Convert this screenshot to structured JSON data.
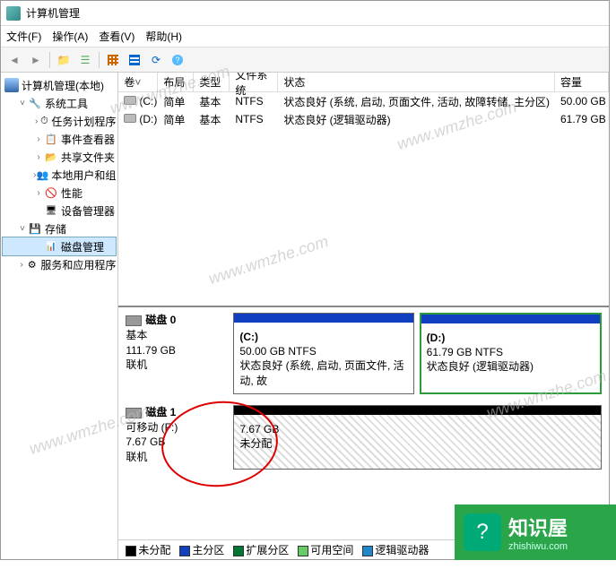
{
  "window": {
    "title": "计算机管理"
  },
  "menu": {
    "file": "文件(F)",
    "action": "操作(A)",
    "view": "查看(V)",
    "help": "帮助(H)"
  },
  "tree": {
    "root": "计算机管理(本地)",
    "systools": "系统工具",
    "task": "任务计划程序",
    "event": "事件查看器",
    "share": "共享文件夹",
    "users": "本地用户和组",
    "perf": "性能",
    "devmgr": "设备管理器",
    "storage": "存储",
    "diskmgmt": "磁盘管理",
    "services": "服务和应用程序"
  },
  "vol_headers": {
    "vol": "卷",
    "layout": "布局",
    "type": "类型",
    "fs": "文件系统",
    "status": "状态",
    "cap": "容量"
  },
  "volumes": [
    {
      "name": "(C:)",
      "layout": "简单",
      "type": "基本",
      "fs": "NTFS",
      "status": "状态良好 (系统, 启动, 页面文件, 活动, 故障转储, 主分区)",
      "cap": "50.00 GB"
    },
    {
      "name": "(D:)",
      "layout": "简单",
      "type": "基本",
      "fs": "NTFS",
      "status": "状态良好 (逻辑驱动器)",
      "cap": "61.79 GB"
    }
  ],
  "disks": {
    "d0": {
      "name": "磁盘 0",
      "type": "基本",
      "size": "111.79 GB",
      "state": "联机",
      "p0": {
        "letter": "(C:)",
        "size": "50.00 GB NTFS",
        "status": "状态良好 (系统, 启动, 页面文件, 活动, 故"
      },
      "p1": {
        "letter": "(D:)",
        "size": "61.79 GB NTFS",
        "status": "状态良好 (逻辑驱动器)"
      }
    },
    "d1": {
      "name": "磁盘 1",
      "type": "可移动 (F:)",
      "size": "7.67 GB",
      "state": "联机",
      "p0": {
        "size": "7.67 GB",
        "status": "未分配"
      }
    }
  },
  "legend": {
    "unalloc": "未分配",
    "primary": "主分区",
    "extended": "扩展分区",
    "free": "可用空间",
    "logical": "逻辑驱动器"
  },
  "brand": {
    "name": "知识屋",
    "domain": "zhishiwu.com",
    "watermark": "www.wmzhe.com"
  }
}
